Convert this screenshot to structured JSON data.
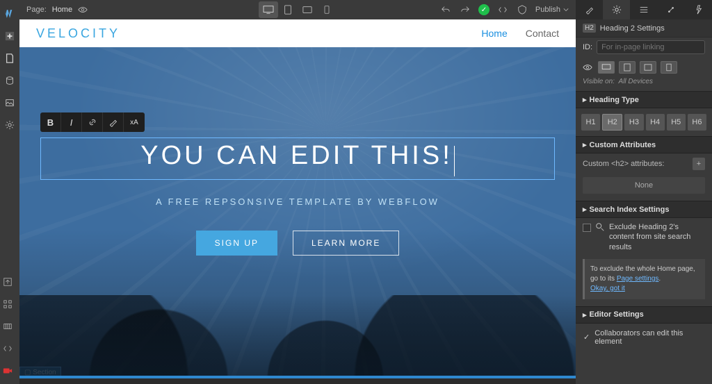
{
  "topbar": {
    "page_label": "Page:",
    "page_name": "Home",
    "publish_label": "Publish"
  },
  "site": {
    "brand": "VELOCITY",
    "nav": {
      "home": "Home",
      "contact": "Contact"
    },
    "headline": "YOU CAN EDIT THIS!",
    "subhead": "A FREE REPSONSIVE TEMPLATE BY WEBFLOW",
    "cta_primary": "SIGN UP",
    "cta_secondary": "LEARN MORE",
    "section_tag": "Section"
  },
  "richtext_toolbar": {
    "bold": "B",
    "italic": "I",
    "sup": "xA"
  },
  "panel": {
    "title": "Heading 2 Settings",
    "tag": "H2",
    "id_label": "ID:",
    "id_placeholder": "For in-page linking",
    "visible_on": "Visible on:",
    "visible_value": "All Devices",
    "section_heading_type": "Heading Type",
    "htypes": [
      "H1",
      "H2",
      "H3",
      "H4",
      "H5",
      "H6"
    ],
    "section_custom_attr": "Custom Attributes",
    "custom_attr_label": "Custom <h2> attributes:",
    "none": "None",
    "section_search": "Search Index Settings",
    "search_exclude": "Exclude Heading 2's content from site search results",
    "search_note_1": "To exclude the whole Home page, go to its ",
    "search_note_link": "Page settings",
    "search_note_2": ".",
    "search_ok": "Okay, got it",
    "section_editor": "Editor Settings",
    "editor_collab": "Collaborators can edit this element"
  }
}
